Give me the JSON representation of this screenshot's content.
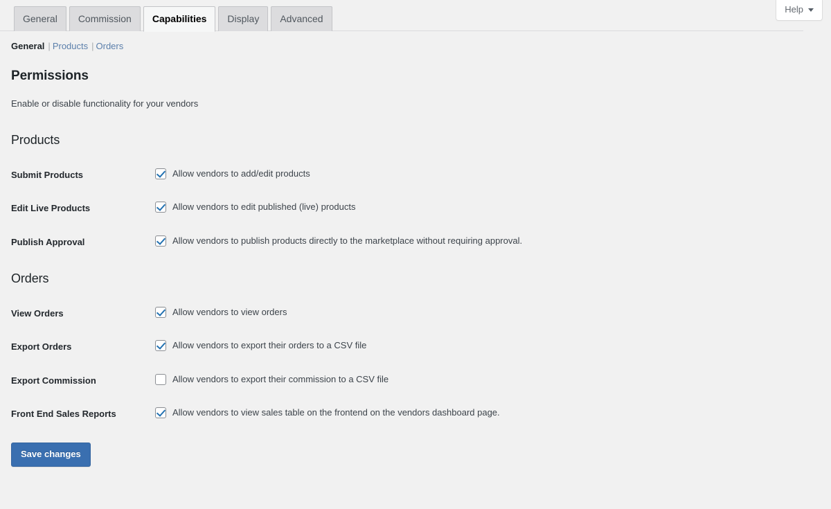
{
  "help": {
    "label": "Help",
    "caret_icon": "chevron-down-icon"
  },
  "tabs": [
    {
      "label": "General",
      "active": false
    },
    {
      "label": "Commission",
      "active": false
    },
    {
      "label": "Capabilities",
      "active": true
    },
    {
      "label": "Display",
      "active": false
    },
    {
      "label": "Advanced",
      "active": false
    }
  ],
  "subnav": {
    "items": [
      {
        "label": "General",
        "current": true
      },
      {
        "label": "Products",
        "current": false
      },
      {
        "label": "Orders",
        "current": false
      }
    ],
    "separator": "|"
  },
  "page": {
    "title": "Permissions",
    "description": "Enable or disable functionality for your vendors"
  },
  "sections": [
    {
      "title": "Products",
      "rows": [
        {
          "label": "Submit Products",
          "text": "Allow vendors to add/edit products",
          "checked": true
        },
        {
          "label": "Edit Live Products",
          "text": "Allow vendors to edit published (live) products",
          "checked": true
        },
        {
          "label": "Publish Approval",
          "text": "Allow vendors to publish products directly to the marketplace without requiring approval.",
          "checked": true
        }
      ]
    },
    {
      "title": "Orders",
      "rows": [
        {
          "label": "View Orders",
          "text": "Allow vendors to view orders",
          "checked": true
        },
        {
          "label": "Export Orders",
          "text": "Allow vendors to export their orders to a CSV file",
          "checked": true
        },
        {
          "label": "Export Commission",
          "text": "Allow vendors to export their commission to a CSV file",
          "checked": false
        },
        {
          "label": "Front End Sales Reports",
          "text": "Allow vendors to view sales table on the frontend on the vendors dashboard page.",
          "checked": true
        }
      ]
    }
  ],
  "actions": {
    "save_label": "Save changes"
  },
  "colors": {
    "page_background": "#f1f1f1",
    "accent_link": "#5b7fab",
    "checkbox_check": "#2271b1",
    "primary_button": "#3a6fb0",
    "tab_inactive": "#dcdcde",
    "tab_active": "#f6f7f7"
  }
}
